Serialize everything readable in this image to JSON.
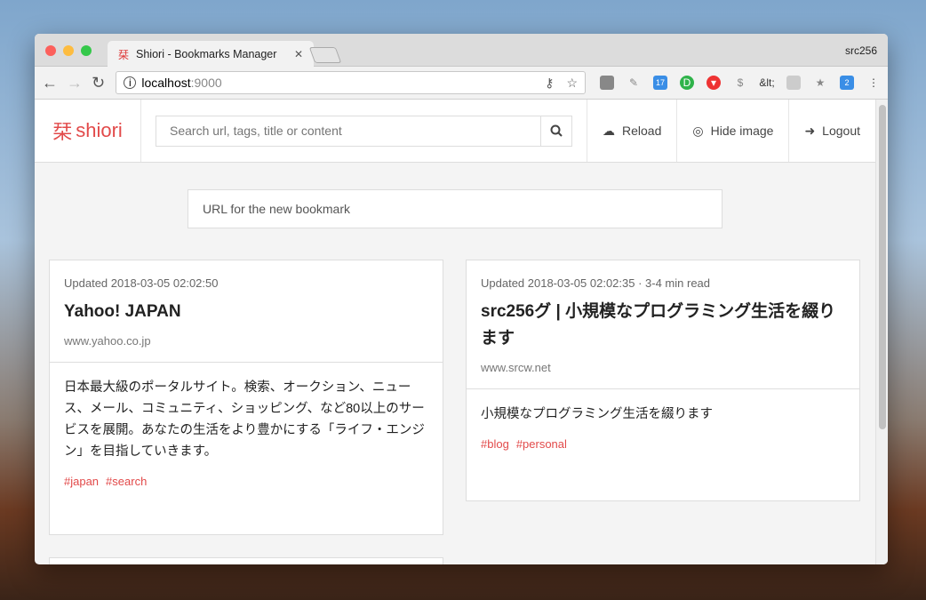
{
  "browser": {
    "tab_title": "Shiori - Bookmarks Manager",
    "tab_icon": "栞",
    "profile": "src256",
    "url_host": "localhost",
    "url_port": ":9000",
    "ext_text": "&lt;"
  },
  "header": {
    "logo_kanji": "栞",
    "logo_text": "shiori",
    "search_placeholder": "Search url, tags, title or content",
    "reload": "Reload",
    "hide_image": "Hide image",
    "logout": "Logout"
  },
  "new_bookmark_placeholder": "URL for the new bookmark",
  "bookmarks": [
    {
      "meta": "Updated 2018-03-05 02:02:50",
      "title": "Yahoo! JAPAN",
      "url": "www.yahoo.co.jp",
      "excerpt": "日本最大級のポータルサイト。検索、オークション、ニュース、メール、コミュニティ、ショッピング、など80以上のサービスを展開。あなたの生活をより豊かにする「ライフ・エンジン」を目指していきます。",
      "tags": [
        "#japan",
        "#search"
      ]
    },
    {
      "meta": "Updated 2018-03-05 02:02:35 · 3-4 min read",
      "title": "src256グ | 小規模なプログラミング生活を綴ります",
      "url": "www.srcw.net",
      "excerpt": "小規模なプログラミング生活を綴ります",
      "tags": [
        "#blog",
        "#personal"
      ]
    }
  ]
}
